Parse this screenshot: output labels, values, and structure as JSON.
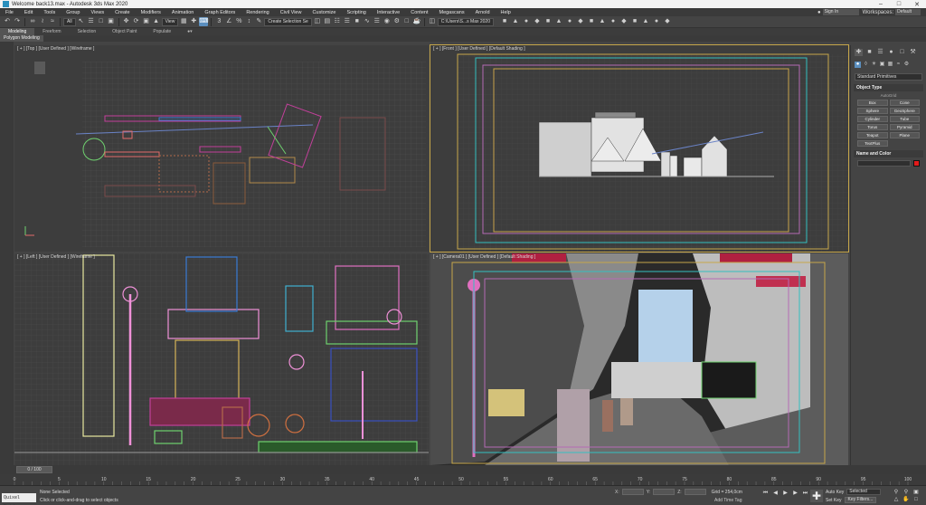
{
  "window": {
    "title": "Welcome back13.max - Autodesk 3ds Max 2020"
  },
  "menu": [
    "File",
    "Edit",
    "Tools",
    "Group",
    "Views",
    "Create",
    "Modifiers",
    "Animation",
    "Graph Editors",
    "Rendering",
    "Civil View",
    "Customize",
    "Scripting",
    "Interactive",
    "Content",
    "Megascans",
    "Arnold",
    "Help"
  ],
  "signin": {
    "label": "Sign In",
    "icon": "user-icon"
  },
  "workspace": {
    "label": "Workspaces:",
    "value": "Default"
  },
  "toolbar": {
    "filter_value": "All",
    "view_value": "View",
    "named_selection_value": "Create Selection Se",
    "project_path_value": "C:\\Users\\S...s Max 2020"
  },
  "ribbon": {
    "tabs": [
      "Modeling",
      "Freeform",
      "Selection",
      "Object Paint",
      "Populate"
    ],
    "active": "Modeling",
    "sub_label": "Polygon Modeling"
  },
  "viewports": {
    "top": "[ + ] [Top ] [User Defined ] [Wireframe ]",
    "front": "[ + ] [Front ] [User Defined ] [Default Shading ]",
    "left": "[ + ] [Left ] [User Defined ] [Wireframe ]",
    "persp": "[ + ] [Camera01 ] [User Defined ] [Default Shading ]"
  },
  "command_panel": {
    "category_dropdown": "Standard Primitives",
    "object_type": {
      "header": "Object Type",
      "autogrid": "AutoGrid",
      "buttons": [
        "Box",
        "Cone",
        "Sphere",
        "GeoSphere",
        "Cylinder",
        "Tube",
        "Torus",
        "Pyramid",
        "Teapot",
        "Plane",
        "TextPlus"
      ]
    },
    "name_and_color": {
      "header": "Name and Color",
      "color": "#e21b1b"
    }
  },
  "timeline": {
    "frame_display": "0 / 100",
    "ticks": [
      "0",
      "5",
      "10",
      "15",
      "20",
      "25",
      "30",
      "35",
      "40",
      "45",
      "50",
      "55",
      "60",
      "65",
      "70",
      "75",
      "80",
      "85",
      "90",
      "95",
      "100"
    ]
  },
  "status": {
    "maxscript": "Quixel Bridg",
    "selection": "None Selected",
    "prompt": "Click or click-and-drag to select objects",
    "x_label": "X:",
    "y_label": "Y:",
    "z_label": "Z:",
    "grid": "Grid = 254,0cm",
    "add_time_tag": "Add Time Tag",
    "auto_key": "Auto Key",
    "auto_key_value": "Selected",
    "set_key": "Set Key",
    "key_filters": "Key Filters..."
  }
}
